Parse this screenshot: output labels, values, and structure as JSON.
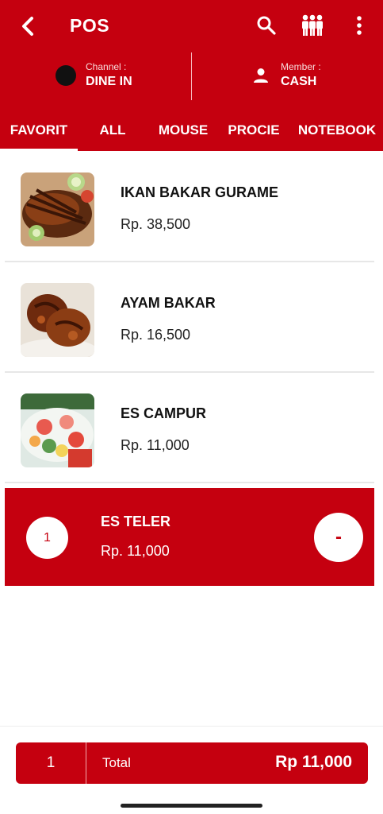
{
  "app": {
    "title": "POS"
  },
  "header": {
    "channel": {
      "label": "Channel :",
      "value": "DINE IN"
    },
    "member": {
      "label": "Member :",
      "value": "CASH"
    }
  },
  "tabs": [
    {
      "label": "FAVORIT",
      "active": true
    },
    {
      "label": "ALL"
    },
    {
      "label": "MOUSE"
    },
    {
      "label": "PROCIE"
    },
    {
      "label": "NOTEBOOK"
    }
  ],
  "items": [
    {
      "name": "IKAN BAKAR GURAME",
      "price": "Rp. 38,500",
      "image": "grilled-fish"
    },
    {
      "name": "AYAM BAKAR",
      "price": "Rp. 16,500",
      "image": "grilled-chicken"
    },
    {
      "name": "ES CAMPUR",
      "price": "Rp. 11,000",
      "image": "mixed-ice-dessert"
    }
  ],
  "selected_item": {
    "qty": "1",
    "name": "ES TELER",
    "price": "Rp. 11,000",
    "minus_label": "-"
  },
  "total": {
    "qty": "1",
    "label": "Total",
    "amount": "Rp 11,000"
  },
  "colors": {
    "primary": "#c5000f",
    "background": "#ffffff"
  }
}
